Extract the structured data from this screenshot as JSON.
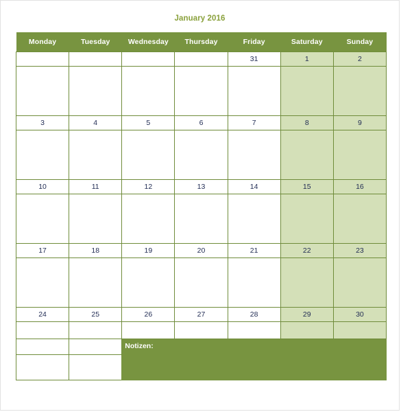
{
  "document": {
    "title": "January 2016",
    "title_color": "#8aa13c"
  },
  "calendar": {
    "month": "January",
    "year": "2016",
    "header_bg": "#789440",
    "grid_color": "#6f8c3a",
    "weekend_bg": "#d4e0b8",
    "date_color": "#1f2a52",
    "weekdays": [
      "Monday",
      "Tuesday",
      "Wednesday",
      "Thursday",
      "Friday",
      "Saturday",
      "Sunday"
    ],
    "weeks": [
      {
        "days": [
          {
            "label": "",
            "weekend": false
          },
          {
            "label": "",
            "weekend": false
          },
          {
            "label": "",
            "weekend": false
          },
          {
            "label": "",
            "weekend": false
          },
          {
            "label": "31",
            "weekend": false
          },
          {
            "label": "1",
            "weekend": true
          },
          {
            "label": "2",
            "weekend": true
          }
        ]
      },
      {
        "days": [
          {
            "label": "3",
            "weekend": false
          },
          {
            "label": "4",
            "weekend": false
          },
          {
            "label": "5",
            "weekend": false
          },
          {
            "label": "6",
            "weekend": false
          },
          {
            "label": "7",
            "weekend": false
          },
          {
            "label": "8",
            "weekend": true
          },
          {
            "label": "9",
            "weekend": true
          }
        ]
      },
      {
        "days": [
          {
            "label": "10",
            "weekend": false
          },
          {
            "label": "11",
            "weekend": false
          },
          {
            "label": "12",
            "weekend": false
          },
          {
            "label": "13",
            "weekend": false
          },
          {
            "label": "14",
            "weekend": false
          },
          {
            "label": "15",
            "weekend": true
          },
          {
            "label": "16",
            "weekend": true
          }
        ]
      },
      {
        "days": [
          {
            "label": "17",
            "weekend": false
          },
          {
            "label": "18",
            "weekend": false
          },
          {
            "label": "19",
            "weekend": false
          },
          {
            "label": "20",
            "weekend": false
          },
          {
            "label": "21",
            "weekend": false
          },
          {
            "label": "22",
            "weekend": true
          },
          {
            "label": "23",
            "weekend": true
          }
        ]
      },
      {
        "days": [
          {
            "label": "24",
            "weekend": false
          },
          {
            "label": "25",
            "weekend": false
          },
          {
            "label": "26",
            "weekend": false
          },
          {
            "label": "27",
            "weekend": false
          },
          {
            "label": "28",
            "weekend": false
          },
          {
            "label": "29",
            "weekend": true
          },
          {
            "label": "30",
            "weekend": true
          }
        ]
      }
    ],
    "notes": {
      "label": "Notizen:",
      "block_bg": "#789440",
      "text_color": "#ffffff"
    }
  }
}
